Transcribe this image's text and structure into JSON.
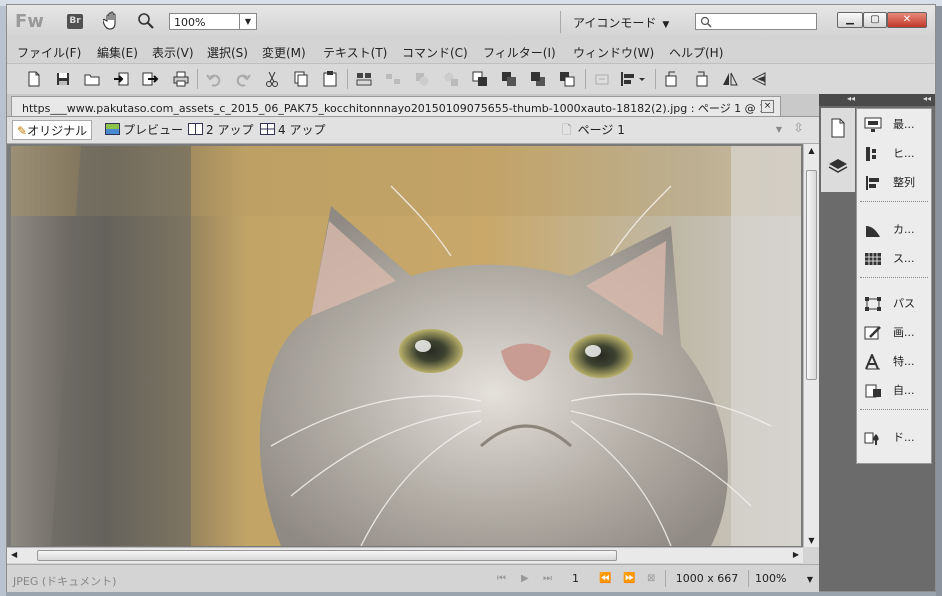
{
  "app": {
    "logo": "Fw",
    "bridge_label": "Br",
    "zoom_value": "100%",
    "workspace_mode": "アイコンモード",
    "search_placeholder": ""
  },
  "menu": [
    "ファイル(F)",
    "編集(E)",
    "表示(V)",
    "選択(S)",
    "変更(M)",
    "テキスト(T)",
    "コマンド(C)",
    "フィルター(I)",
    "ウィンドウ(W)",
    "ヘルプ(H)"
  ],
  "document": {
    "tab_title": "https___www.pakutaso.com_assets_c_2015_06_PAK75_kocchitonnnayo20150109075655-thumb-1000xauto-18182(2).jpg : ページ 1 @ 100...",
    "close_glyph": "×"
  },
  "view_modes": {
    "original": "オリジナル",
    "preview": "プレビュー",
    "two_up": "2 アップ",
    "four_up": "4 アップ"
  },
  "page_selector": "ページ 1",
  "status": {
    "doc_type": "JPEG (ドキュメント)",
    "page_number": "1",
    "image_size": "1000 x 667",
    "zoom": "100%"
  },
  "panels": {
    "items": [
      "最...",
      "ヒ...",
      "整列",
      "カ...",
      "ス...",
      "パス",
      "画...",
      "特...",
      "自...",
      "ド..."
    ]
  },
  "colors": {
    "close_button": "#c0392b",
    "panel_bg": "#6b6b6b"
  }
}
